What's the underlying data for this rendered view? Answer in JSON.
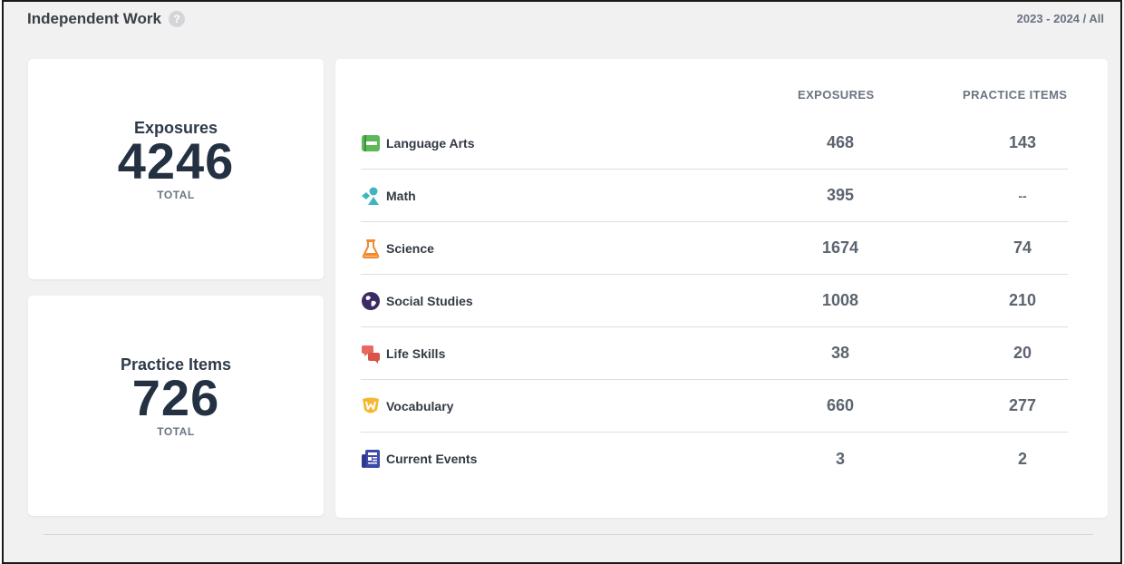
{
  "header": {
    "title": "Independent Work",
    "period": "2023 - 2024 / All"
  },
  "summary": {
    "exposures": {
      "label": "Exposures",
      "value": "4246",
      "sub": "TOTAL"
    },
    "practice": {
      "label": "Practice Items",
      "value": "726",
      "sub": "TOTAL"
    }
  },
  "table": {
    "columns": {
      "exposures": "EXPOSURES",
      "practice": "PRACTICE ITEMS"
    },
    "rows": [
      {
        "subject": "Language Arts",
        "icon": "book-icon",
        "exposures": "468",
        "practice": "143"
      },
      {
        "subject": "Math",
        "icon": "shapes-icon",
        "exposures": "395",
        "practice": "--"
      },
      {
        "subject": "Science",
        "icon": "flask-icon",
        "exposures": "1674",
        "practice": "74"
      },
      {
        "subject": "Social Studies",
        "icon": "globe-icon",
        "exposures": "1008",
        "practice": "210"
      },
      {
        "subject": "Life Skills",
        "icon": "chat-bubbles-icon",
        "exposures": "38",
        "practice": "20"
      },
      {
        "subject": "Vocabulary",
        "icon": "w-badge-icon",
        "exposures": "660",
        "practice": "277"
      },
      {
        "subject": "Current Events",
        "icon": "newspaper-icon",
        "exposures": "3",
        "practice": "2"
      }
    ]
  },
  "colors": {
    "background": "#f1f1f2",
    "card": "#ffffff",
    "heading": "#243142",
    "language_arts": "#5db85a",
    "math": "#3db6c2",
    "science": "#f08a2c",
    "social_studies": "#3b2a63",
    "life_skills": "#e8675e",
    "vocabulary": "#f5b72f",
    "current_events": "#3d4aa8"
  }
}
